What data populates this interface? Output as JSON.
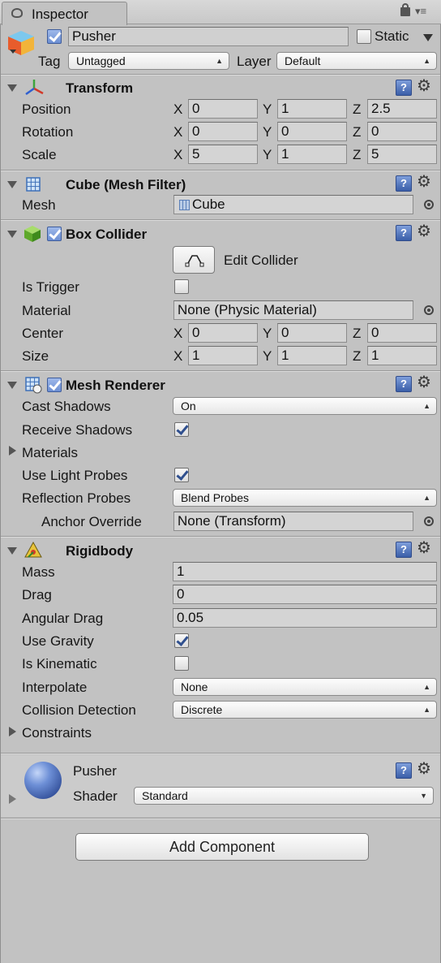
{
  "tab": {
    "title": "Inspector"
  },
  "object": {
    "name": "Pusher",
    "static_label": "Static",
    "tag_label": "Tag",
    "tag_value": "Untagged",
    "layer_label": "Layer",
    "layer_value": "Default",
    "active": true
  },
  "transform": {
    "title": "Transform",
    "position_label": "Position",
    "rotation_label": "Rotation",
    "scale_label": "Scale",
    "axis_x": "X",
    "axis_y": "Y",
    "axis_z": "Z",
    "position": {
      "x": "0",
      "y": "1",
      "z": "2.5"
    },
    "rotation": {
      "x": "0",
      "y": "0",
      "z": "0"
    },
    "scale": {
      "x": "5",
      "y": "1",
      "z": "5"
    }
  },
  "mesh_filter": {
    "title": "Cube (Mesh Filter)",
    "mesh_label": "Mesh",
    "mesh_value": "Cube"
  },
  "box_collider": {
    "title": "Box Collider",
    "enabled": true,
    "edit_label": "Edit Collider",
    "is_trigger_label": "Is Trigger",
    "is_trigger": false,
    "material_label": "Material",
    "material_value": "None (Physic Material)",
    "center_label": "Center",
    "center": {
      "x": "0",
      "y": "0",
      "z": "0"
    },
    "size_label": "Size",
    "size": {
      "x": "1",
      "y": "1",
      "z": "1"
    }
  },
  "mesh_renderer": {
    "title": "Mesh Renderer",
    "enabled": true,
    "cast_shadows_label": "Cast Shadows",
    "cast_shadows_value": "On",
    "receive_shadows_label": "Receive Shadows",
    "receive_shadows": true,
    "materials_label": "Materials",
    "use_light_probes_label": "Use Light Probes",
    "use_light_probes": true,
    "reflection_probes_label": "Reflection Probes",
    "reflection_probes_value": "Blend Probes",
    "anchor_override_label": "Anchor Override",
    "anchor_override_value": "None (Transform)"
  },
  "rigidbody": {
    "title": "Rigidbody",
    "mass_label": "Mass",
    "mass": "1",
    "drag_label": "Drag",
    "drag": "0",
    "angular_drag_label": "Angular Drag",
    "angular_drag": "0.05",
    "use_gravity_label": "Use Gravity",
    "use_gravity": true,
    "is_kinematic_label": "Is Kinematic",
    "is_kinematic": false,
    "interpolate_label": "Interpolate",
    "interpolate_value": "None",
    "collision_detection_label": "Collision Detection",
    "collision_detection_value": "Discrete",
    "constraints_label": "Constraints"
  },
  "material": {
    "name": "Pusher",
    "shader_label": "Shader",
    "shader_value": "Standard"
  },
  "add_component": {
    "label": "Add Component"
  },
  "icons": {
    "help": "?",
    "gear": "⚙"
  }
}
